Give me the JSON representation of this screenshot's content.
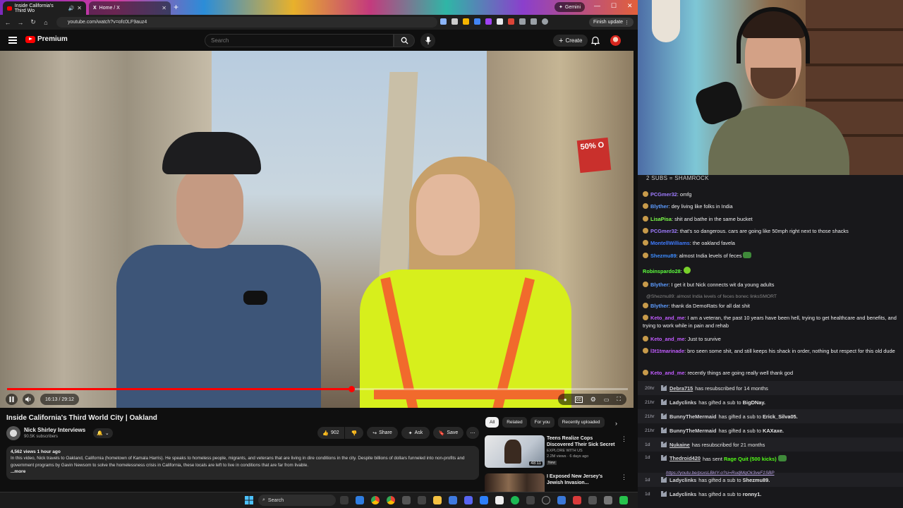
{
  "browser": {
    "tabs": [
      {
        "title": "Inside California's Third Wo"
      },
      {
        "title": "Home / X"
      }
    ],
    "url": "youtube.com/watch?v=ofc0LF9auz4",
    "gemini_label": "Gemini",
    "finish_update_label": "Finish update"
  },
  "youtube": {
    "logo_text": "Premium",
    "search_placeholder": "Search",
    "create_label": "Create",
    "player": {
      "time": "16:13 / 29:12",
      "progress": 0.555
    },
    "video": {
      "title": "Inside California's Third World City | Oakland",
      "channel": "Nick Shirley Interviews",
      "subscribers": "90.5K subscribers",
      "likes": "902",
      "share_label": "Share",
      "ask_label": "Ask",
      "save_label": "Save",
      "views_date": "4,562 views  1 hour ago",
      "description": "In this video, Nick travels to Oakland, California (hometown of Kamala Harris). He speaks to homeless people, migrants, and veterans that are living in dire conditions in the city. Despite billions of dollars funneled into non-profits and government programs by Gavin Newsom to solve the homelessness crisis in California, these locals are left to live in conditions that are far from livable.",
      "more_label": "...more"
    },
    "chips": [
      "All",
      "Related",
      "For you",
      "Recently uploaded"
    ],
    "recommendations": [
      {
        "title": "Teens Realize Cops Discovered Their Sick Secret",
        "channel": "EXPLORE WITH US",
        "stats": "2.2M views · 6 days ago",
        "duration": "48:11",
        "badge": "New"
      },
      {
        "title": "I Exposed New Jersey's Jewish Invasion...",
        "channel": "",
        "stats": "",
        "duration": "",
        "badge": ""
      }
    ]
  },
  "taskbar": {
    "search_label": "Search"
  },
  "stream": {
    "chat_header": "2 SUBS = SHAMROCK",
    "messages": [
      {
        "user": "PCGmer32",
        "color": "#9f7cff",
        "text": "omfg"
      },
      {
        "user": "Blyther",
        "color": "#5c9bff",
        "text": "dey living like folks in India"
      },
      {
        "user": "LisaPisa",
        "color": "#7dff4a",
        "text": "shit and bathe in the same bucket"
      },
      {
        "user": "PCGmer32",
        "color": "#9f7cff",
        "text": "that's so dangerous. cars are going like 50mph right next to those shacks"
      },
      {
        "user": "MontellWilliams",
        "color": "#3f7bff",
        "text": "the oakland favela"
      },
      {
        "user": "Shezmu89",
        "color": "#3d8cff",
        "text": "almost India levels of feces"
      },
      {
        "user": "Robinspardo28",
        "color": "#5dff3e",
        "text": ""
      },
      {
        "user": "Blyther",
        "color": "#5c9bff",
        "text": "I get it but Nick connects wit da young adults"
      },
      {
        "reply": "@Shezmu89: almost India levels of feces bonec linksSMORT"
      },
      {
        "user": "Blyther",
        "color": "#5c9bff",
        "text": "thank da DemoRats for all dat shit"
      },
      {
        "user": "Keto_and_me",
        "color": "#c15cff",
        "text": "I am a veteran, the past 10 years have been hell, trying to get healthcare and benefits, and trying to work while in pain and rehab"
      },
      {
        "user": "Keto_and_me",
        "color": "#c15cff",
        "text": "Just to survive"
      },
      {
        "user": "l3t1tmarinade",
        "color": "#c15cff",
        "text": "bro seen some shit, and still keeps his shack in order, nothing but respect for this old dude"
      },
      {
        "user": "Keto_and_me",
        "color": "#c15cff",
        "text": "recently things are going really well thank god"
      }
    ],
    "events": [
      {
        "time": "20hr",
        "user": "Debra715",
        "desc": "has resubscribed for 14 months",
        "bold": ""
      },
      {
        "time": "21hr",
        "user": "Ladyclinks",
        "desc": "has gifted a sub to",
        "bold": "BigDNay."
      },
      {
        "time": "21hr",
        "user": "BunnyTheMermaid",
        "desc": "has gifted a sub to",
        "bold": "Erick_Silva05."
      },
      {
        "time": "21hr",
        "user": "BunnyTheMermaid",
        "desc": "has gifted a sub to",
        "bold": "KAXaxe."
      },
      {
        "time": "1d",
        "user": "Nukaine",
        "desc": "has resubscribed for 21 months",
        "bold": ""
      },
      {
        "time": "1d",
        "user": "Thedroid420",
        "desc": "has sent",
        "bold": "Rage Quit (500 kicks)"
      },
      {
        "time": "1d",
        "user": "Ladyclinks",
        "desc": "has gifted a sub to",
        "bold": "Shezmu89."
      },
      {
        "time": "1d",
        "user": "Ladyclinks",
        "desc": "has gifted a sub to",
        "bold": "ronny1."
      }
    ],
    "event_link": "https://youtu.be/psxsLBkIY-o?si=RudjMqOk3veF1SBP"
  }
}
